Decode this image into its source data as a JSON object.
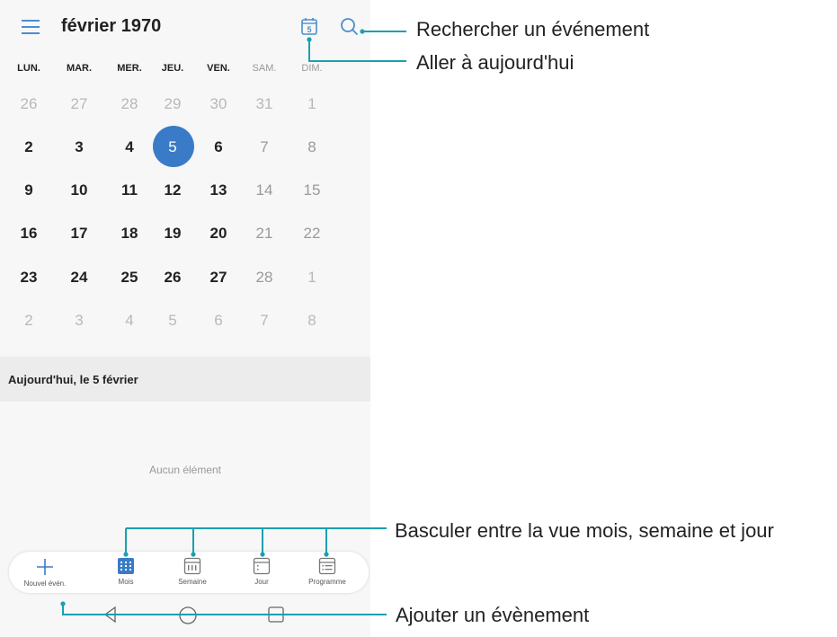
{
  "header": {
    "title": "février 1970"
  },
  "today_icon_digit": "5",
  "weekdays": [
    "LUN.",
    "MAR.",
    "MER.",
    "JEU.",
    "VEN.",
    "SAM.",
    "DIM."
  ],
  "weeks": [
    [
      "26",
      "27",
      "28",
      "29",
      "30",
      "31",
      "1"
    ],
    [
      "2",
      "3",
      "4",
      "5",
      "6",
      "7",
      "8"
    ],
    [
      "9",
      "10",
      "11",
      "12",
      "13",
      "14",
      "15"
    ],
    [
      "16",
      "17",
      "18",
      "19",
      "20",
      "21",
      "22"
    ],
    [
      "23",
      "24",
      "25",
      "26",
      "27",
      "28",
      "1"
    ],
    [
      "2",
      "3",
      "4",
      "5",
      "6",
      "7",
      "8"
    ]
  ],
  "selected_day": "5",
  "today_section": {
    "label": "Aujourd'hui, le  5 février",
    "empty": "Aucun élément"
  },
  "bottom_tabs": {
    "new_event": "Nouvel évén.",
    "month": "Mois",
    "week": "Semaine",
    "day": "Jour",
    "agenda": "Programme"
  },
  "annotations": {
    "search": "Rechercher un événement",
    "today": "Aller à aujourd'hui",
    "switch_view": "Basculer entre la vue mois, semaine et jour",
    "add_event": "Ajouter un évènement"
  },
  "colors": {
    "accent": "#3a7bc8",
    "callout": "#1aa0b0"
  }
}
